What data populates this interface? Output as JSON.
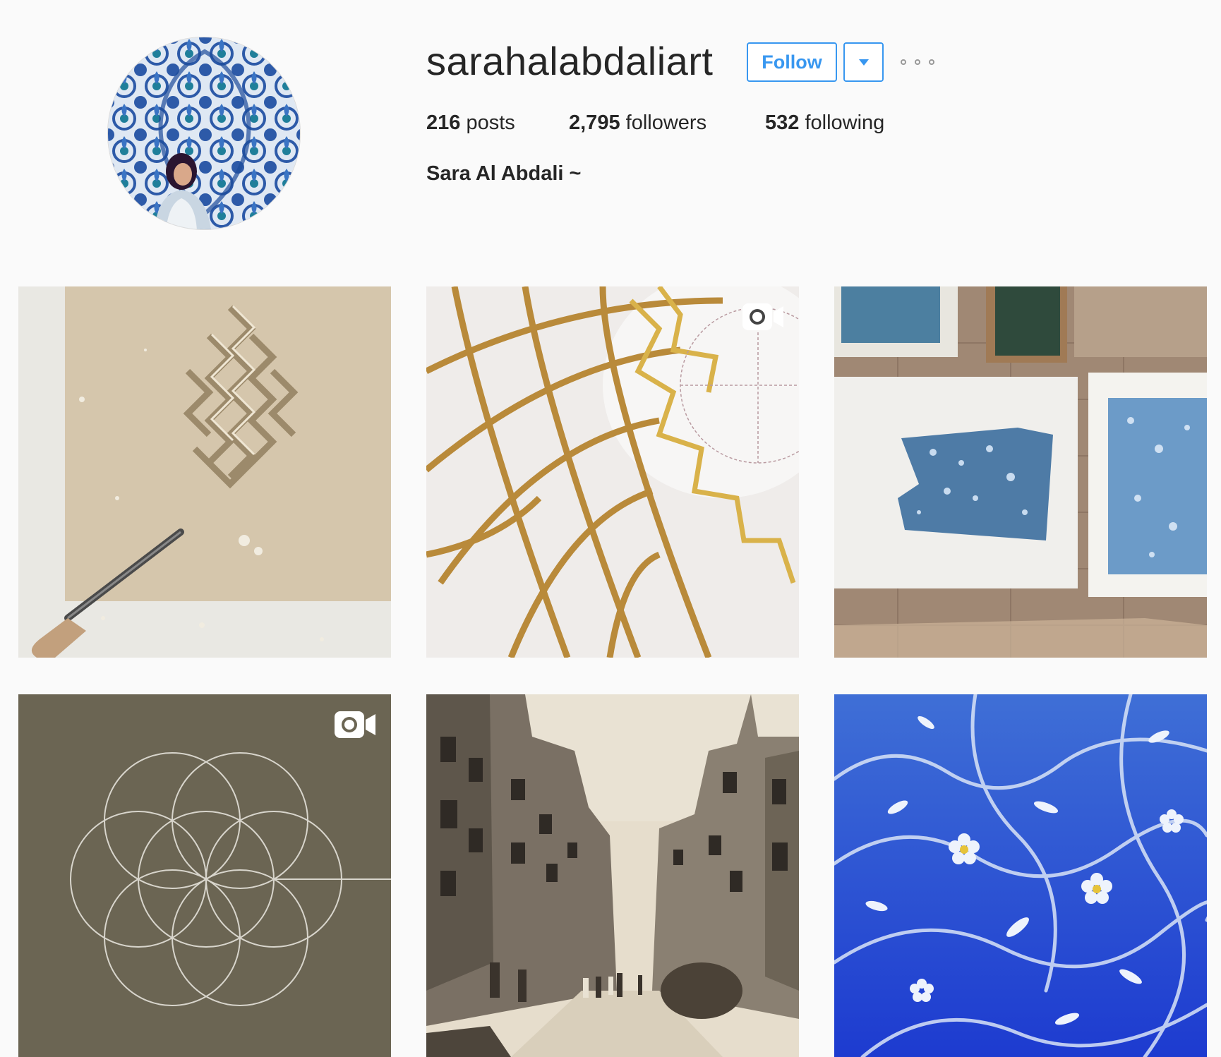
{
  "profile": {
    "username": "sarahalabdaliart",
    "follow_label": "Follow",
    "full_name": "Sara Al Abdali ~",
    "stats": {
      "posts_count": "216",
      "posts_label": "posts",
      "followers_count": "2,795",
      "followers_label": "followers",
      "following_count": "532",
      "following_label": "following"
    }
  },
  "colors": {
    "accent": "#3897f0",
    "background": "#fafafa",
    "text": "#262626"
  },
  "posts": [
    {
      "name": "carved-plaster-geometric-pattern",
      "is_video": false
    },
    {
      "name": "gold-leaf-geometric-painting",
      "is_video": true
    },
    {
      "name": "blue-monoprint-papers",
      "is_video": false
    },
    {
      "name": "flower-of-life-circles",
      "is_video": true
    },
    {
      "name": "vintage-street-photograph",
      "is_video": false
    },
    {
      "name": "blue-floral-painting",
      "is_video": false
    }
  ]
}
